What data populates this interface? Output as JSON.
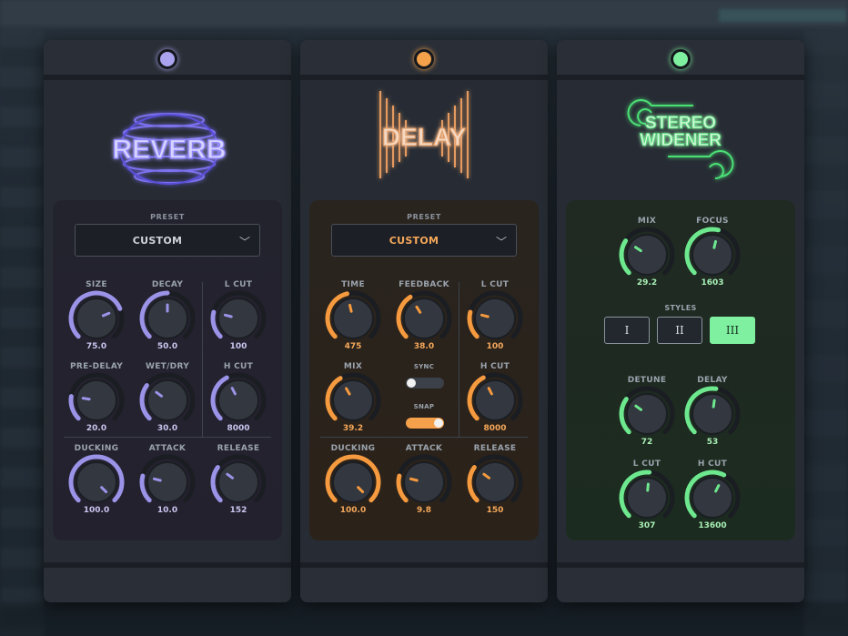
{
  "plugins": [
    {
      "id": "reverb",
      "logo_text": "REVERB",
      "led_color": "#a9a3f0",
      "accent": "#9b93e8",
      "preset_label": "PRESET",
      "preset_value": "CUSTOM",
      "knobs": [
        {
          "label": "SIZE",
          "value": "75.0",
          "level": 0.75
        },
        {
          "label": "DECAY",
          "value": "50.0",
          "level": 0.5
        },
        {
          "label": "L CUT",
          "value": "100",
          "level": 0.22
        },
        {
          "label": "PRE-DELAY",
          "value": "20.0",
          "level": 0.2
        },
        {
          "label": "WET/DRY",
          "value": "30.0",
          "level": 0.3
        },
        {
          "label": "H CUT",
          "value": "8000",
          "level": 0.4
        },
        {
          "label": "DUCKING",
          "value": "100.0",
          "level": 1.0
        },
        {
          "label": "ATTACK",
          "value": "10.0",
          "level": 0.22
        },
        {
          "label": "RELEASE",
          "value": "152",
          "level": 0.3
        }
      ]
    },
    {
      "id": "delay",
      "logo_text": "DELAY",
      "led_color": "#f5a04a",
      "accent": "#f59a3e",
      "preset_label": "PRESET",
      "preset_value": "CUSTOM",
      "knobs": [
        {
          "label": "TIME",
          "value": "475",
          "level": 0.45
        },
        {
          "label": "FEEDBACK",
          "value": "38.0",
          "level": 0.38
        },
        {
          "label": "L CUT",
          "value": "100",
          "level": 0.22
        },
        {
          "label": "MIX",
          "value": "39.2",
          "level": 0.39
        },
        {
          "label": "H CUT",
          "value": "8000",
          "level": 0.4
        },
        {
          "label": "DUCKING",
          "value": "100.0",
          "level": 1.0
        },
        {
          "label": "ATTACK",
          "value": "9.8",
          "level": 0.22
        },
        {
          "label": "RELEASE",
          "value": "150",
          "level": 0.3
        }
      ],
      "sync_label": "SYNC",
      "sync_on": false,
      "snap_label": "SNAP",
      "snap_on": true
    },
    {
      "id": "stereo-widener",
      "logo_line1": "STEREO",
      "logo_line2": "WIDENER",
      "led_color": "#7ef0a0",
      "accent": "#6ee88e",
      "knobs": [
        {
          "label": "MIX",
          "value": "29.2",
          "level": 0.29
        },
        {
          "label": "FOCUS",
          "value": "1603",
          "level": 0.55
        },
        {
          "label": "DETUNE",
          "value": "72",
          "level": 0.3
        },
        {
          "label": "DELAY",
          "value": "53",
          "level": 0.53
        },
        {
          "label": "L CUT",
          "value": "307",
          "level": 0.52
        },
        {
          "label": "H CUT",
          "value": "13600",
          "level": 0.6
        }
      ],
      "styles_label": "STYLES",
      "styles": [
        "I",
        "II",
        "III"
      ],
      "active_style": "III"
    }
  ]
}
